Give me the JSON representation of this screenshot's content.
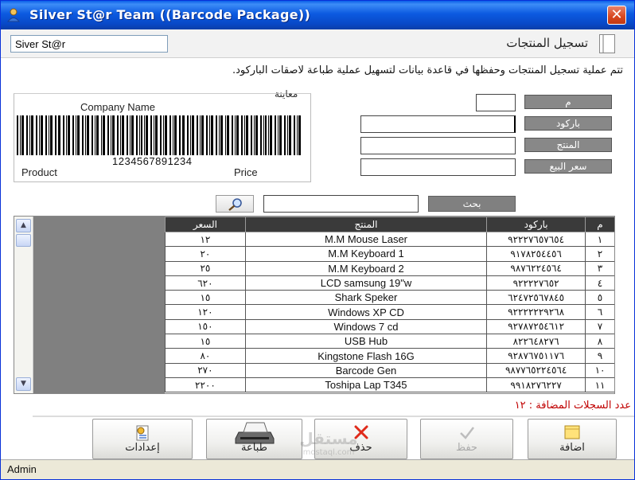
{
  "window": {
    "title": "Silver St@r Team ((Barcode Package))",
    "close_glyph": "✕"
  },
  "header": {
    "company_field_value": "Siver St@r",
    "page_title": "تسجيل المنتجات"
  },
  "description": "تتم عملية تسجيل المنتجات وحفظها في قاعدة بيانات لتسهيل عملية طباعة لاصقات الباركود.",
  "preview": {
    "label": "معاينة",
    "company_name": "Company Name",
    "barcode_number": "1234567891234",
    "product_label": "Product",
    "price_label": "Price"
  },
  "form": {
    "id_label": "م",
    "id_value": "",
    "barcode_label": "باركود",
    "barcode_value": "",
    "product_label": "المنتج",
    "product_value": "",
    "price_label": "سعر البيع",
    "price_value": ""
  },
  "search": {
    "button_label": "بحث",
    "input_value": "",
    "icon": "magnifier-icon"
  },
  "table": {
    "columns": [
      "م",
      "باركود",
      "المنتج",
      "السعر"
    ],
    "rows": [
      {
        "id": "١",
        "barcode": "٩٢٢٢٧٦٥٧٦٥٤",
        "product": "M.M Mouse Laser",
        "price": "١٢"
      },
      {
        "id": "٢",
        "barcode": "٩١٧٨٢٥٤٤٥٦",
        "product": "M.M Keyboard 1",
        "price": "٢٠"
      },
      {
        "id": "٣",
        "barcode": "٩٨٧٦٢٢٤٥٦٤",
        "product": "M.M Keyboard 2",
        "price": "٢٥"
      },
      {
        "id": "٤",
        "barcode": "٩٢٢٢٢٧٦٥٢",
        "product": "LCD samsung 19\"w",
        "price": "٦٢٠"
      },
      {
        "id": "٥",
        "barcode": "٦٢٤٧٢٥٦٧٨٤٥",
        "product": "Shark Speker",
        "price": "١٥"
      },
      {
        "id": "٦",
        "barcode": "٩٢٢٢٢٢٢٩٢٦٨",
        "product": "Windows XP CD",
        "price": "١٢٠"
      },
      {
        "id": "٧",
        "barcode": "٩٢٧٨٧٢٥٤٦١٢",
        "product": "Windows 7 cd",
        "price": "١٥٠"
      },
      {
        "id": "٨",
        "barcode": "٨٢٢٦٤٨٢٧٦",
        "product": "USB Hub",
        "price": "١٥"
      },
      {
        "id": "٩",
        "barcode": "٩٢٨٧٦٧٥١١٧٦",
        "product": "Kingstone Flash 16G",
        "price": "٨٠"
      },
      {
        "id": "١٠",
        "barcode": "٩٨٧٧٦٥٢٢٤٥٦٤",
        "product": "Barcode Gen",
        "price": "٢٧٠"
      },
      {
        "id": "١١",
        "barcode": "٩٩١٨٢٧٦٢٢٧",
        "product": "Toshipa Lap T345",
        "price": "٢٢٠٠"
      }
    ]
  },
  "records_count_text": "عدد السجلات المضافة : ١٢",
  "buttons": {
    "add": "اضافة",
    "save": "حفظ",
    "delete": "حذف",
    "print": "طباعة",
    "settings": "إعدادات"
  },
  "status": {
    "user": "Admin"
  },
  "watermark": {
    "line1": "مستقل",
    "line2": "mostaql.com"
  }
}
